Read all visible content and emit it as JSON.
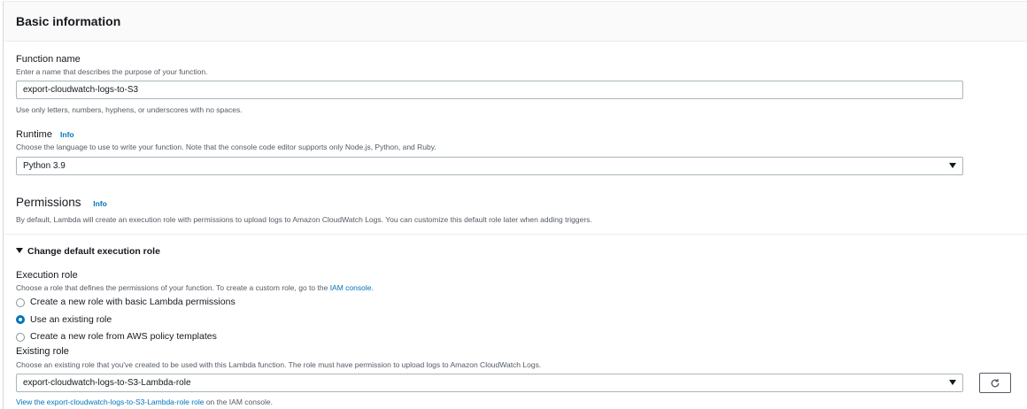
{
  "section": {
    "title": "Basic information"
  },
  "function_name": {
    "label": "Function name",
    "description": "Enter a name that describes the purpose of your function.",
    "value": "export-cloudwatch-logs-to-S3",
    "constraint": "Use only letters, numbers, hyphens, or underscores with no spaces."
  },
  "runtime": {
    "label": "Runtime",
    "info": "Info",
    "description": "Choose the language to use to write your function. Note that the console code editor supports only Node.js, Python, and Ruby.",
    "selected": "Python 3.9"
  },
  "permissions": {
    "title": "Permissions",
    "info": "Info",
    "description": "By default, Lambda will create an execution role with permissions to upload logs to Amazon CloudWatch Logs. You can customize this default role later when adding triggers."
  },
  "execution_role_section": {
    "toggle_label": "Change default execution role",
    "label": "Execution role",
    "description_prefix": "Choose a role that defines the permissions of your function. To create a custom role, go to the ",
    "description_link": "IAM console",
    "description_suffix": ".",
    "options": [
      {
        "label": "Create a new role with basic Lambda permissions",
        "checked": false
      },
      {
        "label": "Use an existing role",
        "checked": true
      },
      {
        "label": "Create a new role from AWS policy templates",
        "checked": false
      }
    ]
  },
  "existing_role": {
    "label": "Existing role",
    "description": "Choose an existing role that you've created to be used with this Lambda function. The role must have permission to upload logs to Amazon CloudWatch Logs.",
    "selected": "export-cloudwatch-logs-to-S3-Lambda-role",
    "view_link": "View the export-cloudwatch-logs-to-S3-Lambda-role role",
    "view_suffix": " on the IAM console."
  },
  "icons": {
    "refresh": "refresh-icon",
    "caret": "caret-down-icon",
    "toggle": "caret-down-filled-icon"
  },
  "colors": {
    "link": "#0073bb",
    "radio_checked": "#0073bb",
    "border": "#aab7b8"
  }
}
